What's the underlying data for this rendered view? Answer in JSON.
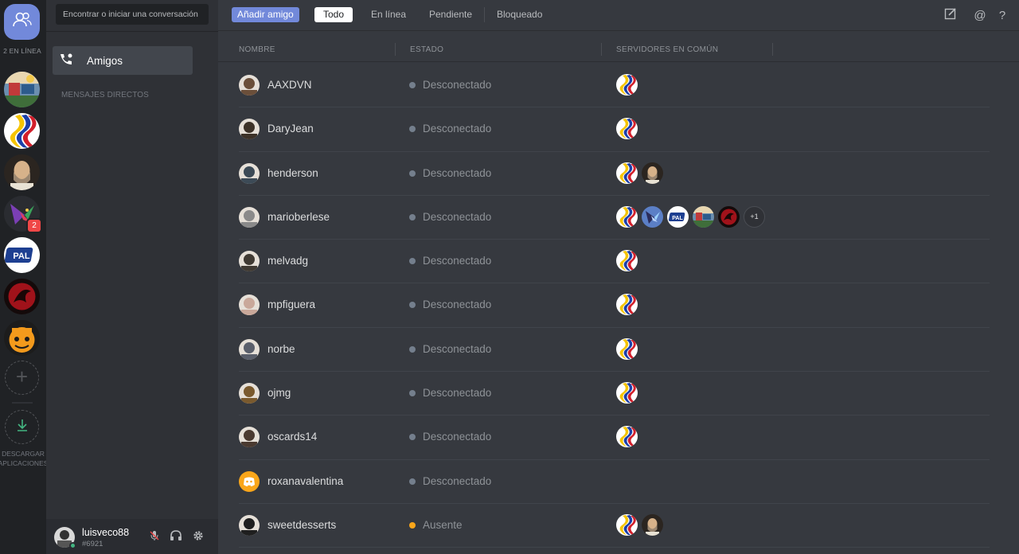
{
  "rail": {
    "online_count": "2 EN LÍNEA",
    "badge": "2",
    "download_label": "DESCARGAR APLICACIONES"
  },
  "sidebar": {
    "search_placeholder": "Encontrar o iniciar una conversación",
    "friends_label": "Amigos",
    "dm_header": "MENSAJES DIRECTOS"
  },
  "user": {
    "name": "luisveco88",
    "tag": "#6921"
  },
  "topbar": {
    "add_friend": "Añadir amigo",
    "tabs": [
      "Todo",
      "En línea",
      "Pendiente",
      "Bloqueado"
    ]
  },
  "table": {
    "headers": [
      "NOMBRE",
      "ESTADO",
      "SERVIDORES EN COMÚN"
    ],
    "rows": [
      {
        "name": "AAXDVN",
        "status": "Desconectado",
        "servers": [
          "venezuela"
        ]
      },
      {
        "name": "DaryJean",
        "status": "Desconectado",
        "servers": [
          "venezuela"
        ]
      },
      {
        "name": "henderson",
        "status": "Desconectado",
        "servers": [
          "venezuela",
          "portrait"
        ]
      },
      {
        "name": "marioberlese",
        "status": "Desconectado",
        "servers": [
          "venezuela",
          "bird",
          "pal",
          "colorful",
          "red-dragon"
        ],
        "more": "+1"
      },
      {
        "name": "melvadg",
        "status": "Desconectado",
        "servers": [
          "venezuela"
        ]
      },
      {
        "name": "mpfiguera",
        "status": "Desconectado",
        "servers": [
          "venezuela"
        ]
      },
      {
        "name": "norbe",
        "status": "Desconectado",
        "servers": [
          "venezuela"
        ]
      },
      {
        "name": "ojmg",
        "status": "Desconectado",
        "servers": [
          "venezuela"
        ]
      },
      {
        "name": "oscards14",
        "status": "Desconectado",
        "servers": [
          "venezuela"
        ]
      },
      {
        "name": "roxanavalentina",
        "status": "Desconectado",
        "servers": []
      },
      {
        "name": "sweetdesserts",
        "status": "Ausente",
        "servers": [
          "venezuela",
          "portrait"
        ]
      }
    ]
  },
  "colors": {
    "accent": "#7289da",
    "online": "#43b581",
    "idle": "#faa61a",
    "offline": "#747f8d"
  }
}
